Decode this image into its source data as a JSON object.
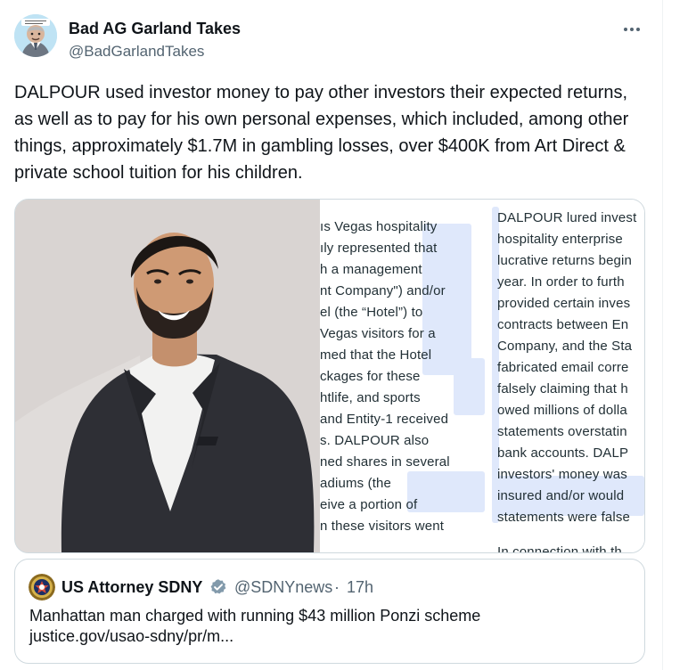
{
  "tweet": {
    "author": {
      "display_name": "Bad AG Garland Takes",
      "handle": "@BadGarlandTakes",
      "avatar_icon": "cartoon-person-avatar"
    },
    "more_icon": "more-options-icon",
    "text": "DALPOUR used investor money to pay other investors their expected returns, as well as to pay for his own personal expenses, which included, among other things, approximately $1.7M in gambling losses, over $400K from Art Direct & private school tuition for his children."
  },
  "media": {
    "middle_lines": [
      "ıs Vegas hospitality",
      "ıly represented that",
      "h a management",
      "nt Company\") and/or",
      "el (the “Hotel”) to",
      "Vegas visitors for a",
      "med that the Hotel",
      "ckages for these",
      "htlife, and sports",
      " and Entity-1 received",
      "s.  DALPOUR also",
      "ned shares in several",
      "adiums (the",
      "eive a portion of",
      "n these visitors went"
    ],
    "right_lines": [
      "DALPOUR lured invest",
      "hospitality enterprise",
      "lucrative returns begin",
      "year.  In order to furth",
      "provided certain inves",
      "contracts between En",
      "Company, and the Sta",
      "fabricated email corre",
      "falsely claiming that h",
      "owed millions of dolla",
      "statements overstatin",
      "bank accounts.  DALP",
      "investors' money was",
      "insured and/or would",
      "statements were false",
      "In connection with th"
    ]
  },
  "quote": {
    "avatar_icon": "doj-seal-icon",
    "name": "US Attorney SDNY",
    "verified_icon": "verified-badge-icon",
    "handle": "@SDNYnews",
    "separator": "·",
    "time": "17h",
    "text_line_1": "Manhattan man charged with running $43 million Ponzi scheme",
    "text_line_2": "justice.gov/usao-sdny/pr/m..."
  },
  "colors": {
    "text_primary": "#0f1419",
    "text_secondary": "#536471",
    "border": "#cfd9de",
    "verified": "#829aab",
    "highlight": "#dfe8fb"
  }
}
